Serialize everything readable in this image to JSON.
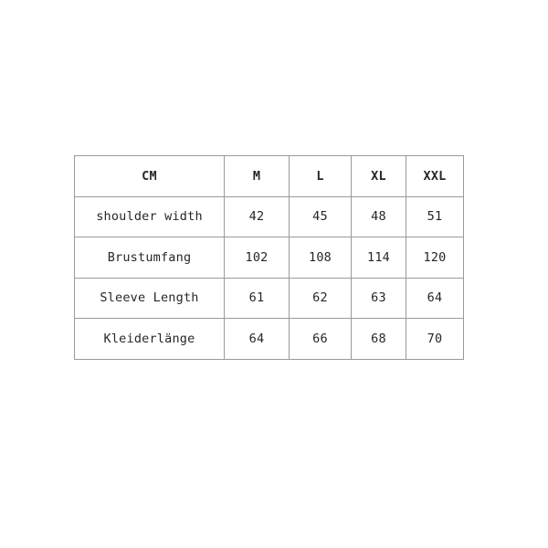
{
  "table": {
    "header": {
      "unit_label": "CM",
      "sizes": [
        "M",
        "L",
        "XL",
        "XXL"
      ]
    },
    "rows": [
      {
        "label": "shoulder width",
        "values": [
          "42",
          "45",
          "48",
          "51"
        ]
      },
      {
        "label": "Brustumfang",
        "values": [
          "102",
          "108",
          "114",
          "120"
        ]
      },
      {
        "label": "Sleeve Length",
        "values": [
          "61",
          "62",
          "63",
          "64"
        ]
      },
      {
        "label": "Kleiderlänge",
        "values": [
          "64",
          "66",
          "68",
          "70"
        ]
      }
    ]
  },
  "colors": {
    "background": "#ffffff",
    "border": "#9a9a9a",
    "text": "#262626"
  }
}
